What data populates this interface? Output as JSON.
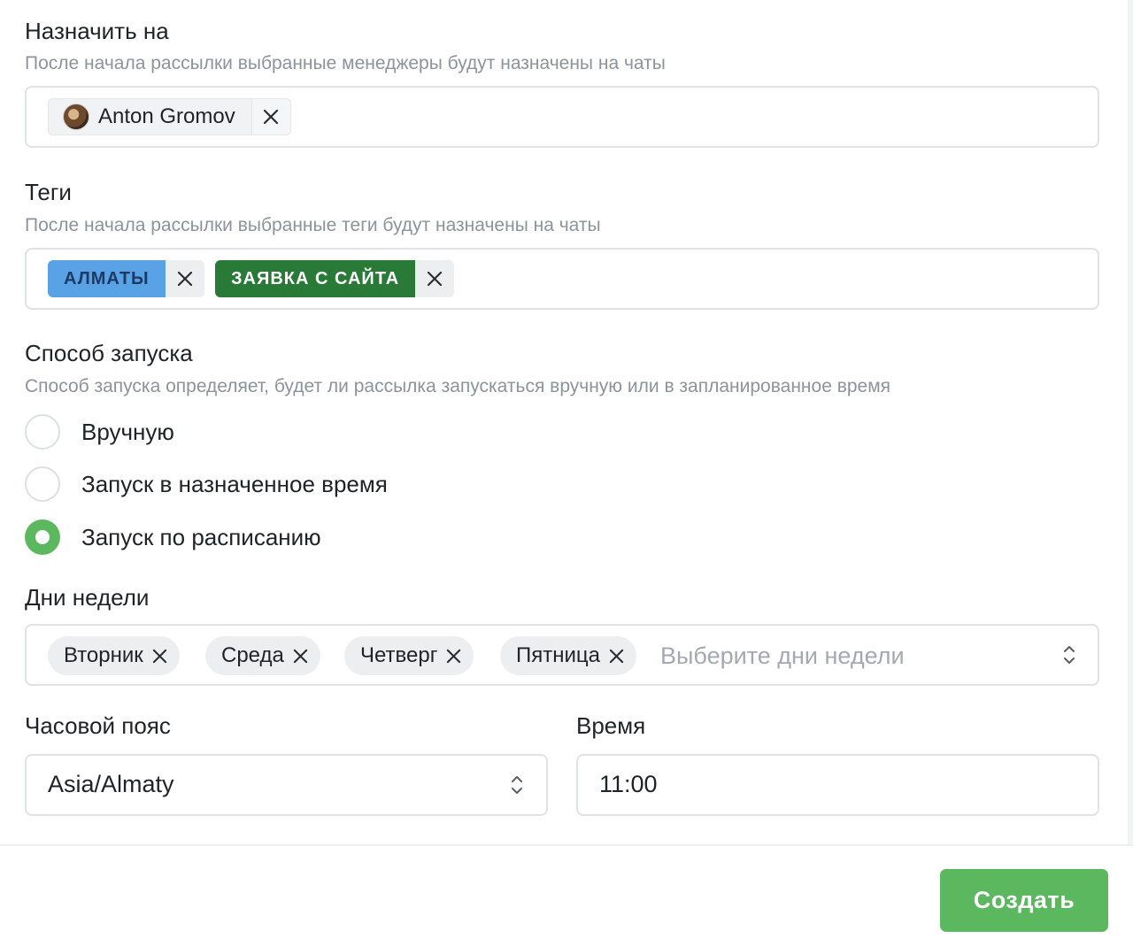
{
  "assign": {
    "title": "Назначить на",
    "hint": "После начала рассылки выбранные менеджеры будут назначены на чаты",
    "selected_user": "Anton Gromov"
  },
  "tags": {
    "title": "Теги",
    "hint": "После начала рассылки выбранные теги будут назначены на чаты",
    "items": [
      {
        "label": "АЛМАТЫ",
        "color": "#5aa2e6"
      },
      {
        "label": "ЗАЯВКА С САЙТА",
        "color": "#2a7a37"
      }
    ]
  },
  "launch": {
    "title": "Способ запуска",
    "hint": "Способ запуска определяет, будет ли рассылка запускаться вручную или в запланированное время",
    "options": [
      {
        "label": "Вручную",
        "checked": false
      },
      {
        "label": "Запуск в назначенное время",
        "checked": false
      },
      {
        "label": "Запуск по расписанию",
        "checked": true
      }
    ]
  },
  "weekdays": {
    "title": "Дни недели",
    "selected": [
      "Вторник",
      "Среда",
      "Четверг",
      "Пятница"
    ],
    "placeholder": "Выберите дни недели"
  },
  "timezone": {
    "label": "Часовой пояс",
    "value": "Asia/Almaty"
  },
  "time": {
    "label": "Время",
    "value": "11:00"
  },
  "footer": {
    "create_label": "Создать"
  },
  "colors": {
    "accent": "#5cb85f",
    "hint_text": "#8d939b",
    "border": "#dfe2e6"
  }
}
